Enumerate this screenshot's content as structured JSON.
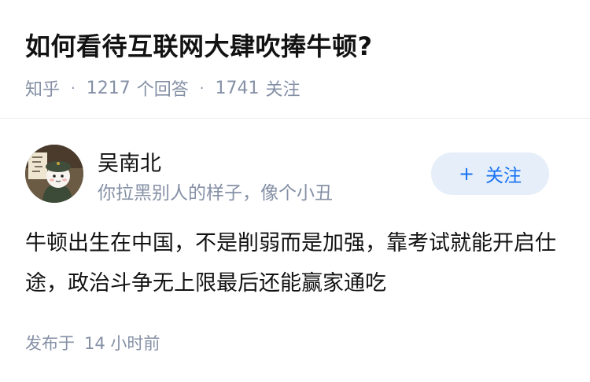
{
  "question": {
    "title": "如何看待互联网大肆吹捧牛顿?",
    "site": "知乎",
    "answer_count": "1217",
    "answer_label": "个回答",
    "follower_count": "1741",
    "follower_label": "关注"
  },
  "author": {
    "name": "吴南北",
    "bio": "你拉黑别人的样子，像个小丑",
    "follow_label": "关注",
    "follow_icon": "plus-icon"
  },
  "answer": {
    "content": "牛顿出生在中国，不是削弱而是加强，靠考试就能开启仕途，政治斗争无上限最后还能赢家通吃",
    "time_prefix": "发布于",
    "time_value": "14 小时前"
  },
  "colors": {
    "text_primary": "#121212",
    "text_secondary": "#8590a6",
    "brand_blue": "#1772f6",
    "follow_bg": "#e5eef9"
  }
}
